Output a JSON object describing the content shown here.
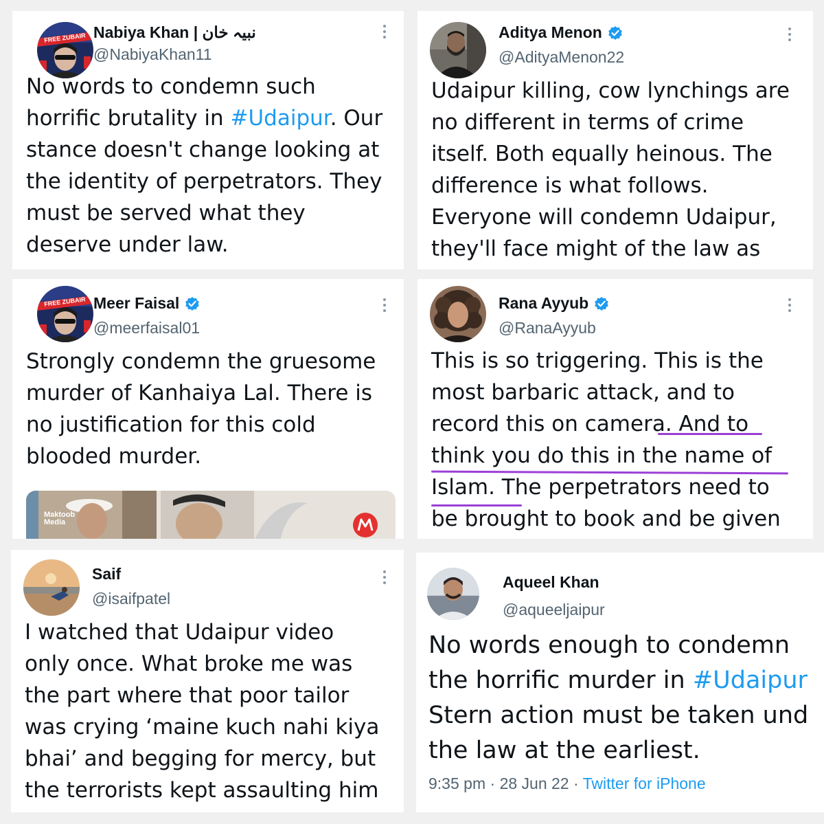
{
  "tweets": [
    {
      "name": "Nabiya Khan | نبیہ خان",
      "handle": "@NabiyaKhan11",
      "verified": false,
      "avatar": "free-zubair-avatar",
      "lines": [
        "No words to condemn such",
        "horrific brutality in ",
        "stance doesn't change looking at",
        "the identity of perpetrators. They",
        "must be served what they",
        "deserve under law."
      ],
      "hashtag": "#Udaipur",
      "after_hashtag": ". Our"
    },
    {
      "name": "Aditya Menon",
      "handle": "@AdityaMenon22",
      "verified": true,
      "avatar": "bearded-man-avatar",
      "lines": [
        "Udaipur killing, cow lynchings are",
        "no different in terms of crime",
        "itself. Both equally heinous. The",
        "difference is what follows.",
        "Everyone will condemn Udaipur,",
        "they'll face might of the law as"
      ]
    },
    {
      "name": "Meer Faisal",
      "handle": "@meerfaisal01",
      "verified": true,
      "avatar": "free-zubair-avatar",
      "lines": [
        "Strongly condemn the gruesome",
        "murder of Kanhaiya Lal. There is",
        "no justification for this cold",
        "blooded murder."
      ],
      "media_label_1": "Maktoob",
      "media_label_2": "Media"
    },
    {
      "name": "Rana Ayyub",
      "handle": "@RanaAyyub",
      "verified": true,
      "avatar": "woman-curly-hair-avatar",
      "lines": [
        "This is so triggering. This is the",
        "most barbaric attack, and to",
        "record this on camera. And to",
        "think you do this in the name of",
        "Islam. The perpetrators need to",
        "be brought to book and be given"
      ]
    },
    {
      "name": "Saif",
      "handle": "@isaifpatel",
      "verified": false,
      "avatar": "beach-sunset-avatar",
      "lines": [
        "I watched that Udaipur video",
        "only once. What broke me was",
        "the part where that poor tailor",
        "was crying ‘maine kuch nahi kiya",
        "bhai’ and begging for mercy, but",
        "the terrorists kept assaulting him"
      ]
    },
    {
      "name": "Aqueel Khan",
      "handle": "@aqueeljaipur",
      "verified": false,
      "avatar": "smiling-man-avatar",
      "lines": [
        "No words enough to condemn",
        "the horrific murder in ",
        "Stern action must be taken und",
        "the law at the earliest."
      ],
      "hashtag": "#Udaipur",
      "time": "9:35 pm",
      "sep": "·",
      "date": "28 Jun 22",
      "source": "Twitter for iPhone"
    }
  ],
  "colors": {
    "link": "#1d9bf0",
    "verified": "#1d9bf0",
    "underline": "#9b3fd6",
    "text": "#0f1419",
    "secondary": "#536471"
  }
}
